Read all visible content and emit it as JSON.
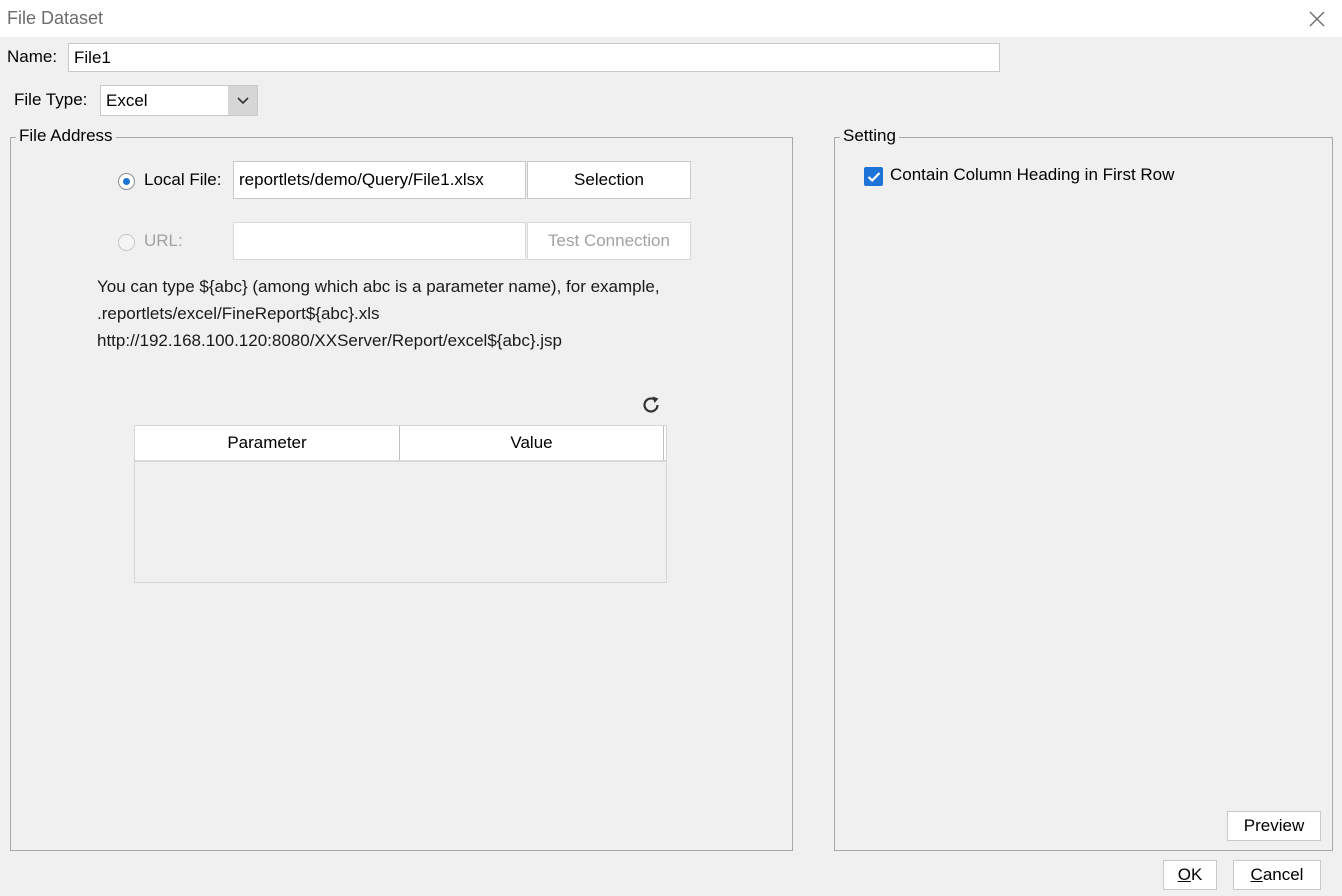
{
  "window": {
    "title": "File Dataset",
    "close_icon": "close-icon"
  },
  "name_field": {
    "label": "Name:",
    "value": "File1"
  },
  "file_type": {
    "label": "File Type:",
    "selected": "Excel"
  },
  "file_address": {
    "legend": "File Address",
    "local_file": {
      "label": "Local File:",
      "selected": true,
      "path": "reportlets/demo/Query/File1.xlsx",
      "button": "Selection"
    },
    "url": {
      "label": "URL:",
      "selected": false,
      "value": "",
      "button": "Test Connection"
    },
    "hint_lines": [
      "You can type ${abc} (among which abc is a parameter name), for example,",
      ".reportlets/excel/FineReport${abc}.xls",
      "http://192.168.100.120:8080/XXServer/Report/excel${abc}.jsp"
    ],
    "refresh_icon": "refresh-icon",
    "table": {
      "columns": [
        "Parameter",
        "Value"
      ],
      "rows": []
    }
  },
  "setting": {
    "legend": "Setting",
    "contain_heading": {
      "label": "Contain Column Heading in First Row",
      "checked": true
    },
    "preview_button": "Preview"
  },
  "footer": {
    "ok_mnemonic": "O",
    "ok_rest": "K",
    "cancel_mnemonic": "C",
    "cancel_rest": "ancel"
  },
  "colors": {
    "accent": "#1e74d6",
    "background": "#f0f0f0"
  }
}
